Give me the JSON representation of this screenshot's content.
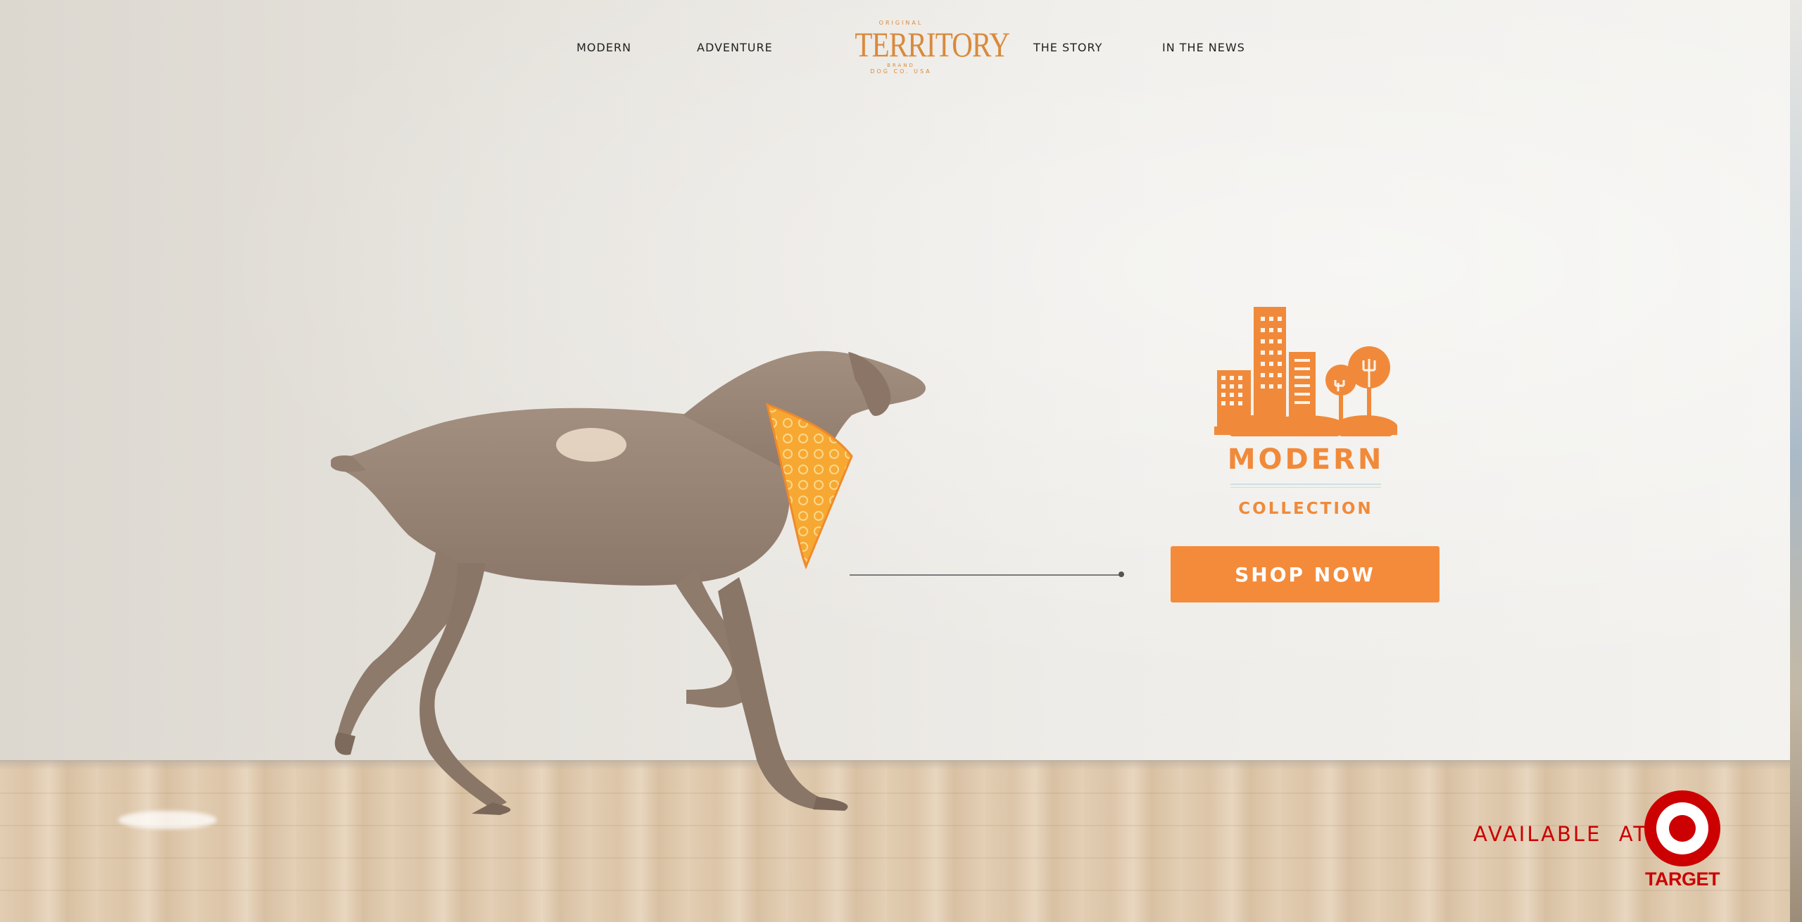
{
  "nav": {
    "links": [
      {
        "label": "MODERN"
      },
      {
        "label": "ADVENTURE"
      },
      {
        "label": "THE STORY"
      },
      {
        "label": "IN THE NEWS"
      }
    ],
    "logo": {
      "top": "ORIGINAL",
      "main": "TERRITORY",
      "sub": "BRAND",
      "bottom": "DOG CO. USA"
    }
  },
  "collection": {
    "icon": "city-skyline-icon",
    "title": "MODERN",
    "subtitle": "COLLECTION",
    "cta_label": "SHOP NOW"
  },
  "retailer": {
    "available_label": "AVAILABLE  AT",
    "brand": "TARGET",
    "icon": "target-bullseye-icon"
  },
  "colors": {
    "accent_orange": "#f38b3a",
    "logo_orange": "#d88a3c",
    "target_red": "#cc0000"
  }
}
